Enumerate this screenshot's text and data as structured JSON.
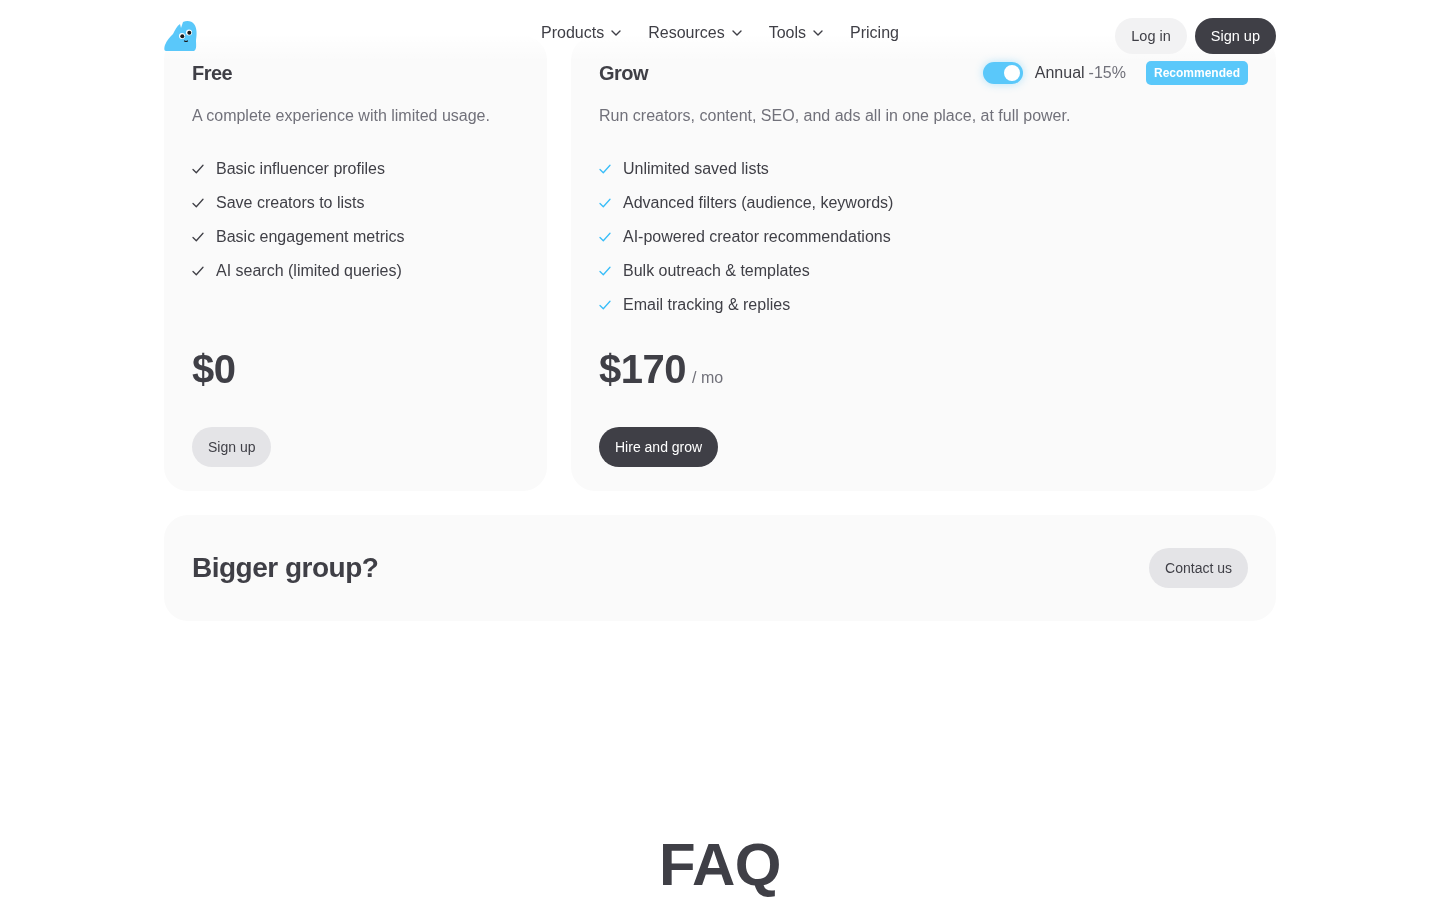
{
  "header": {
    "nav": [
      {
        "label": "Products",
        "has_menu": true
      },
      {
        "label": "Resources",
        "has_menu": true
      },
      {
        "label": "Tools",
        "has_menu": true
      },
      {
        "label": "Pricing",
        "has_menu": false
      }
    ],
    "actions": [
      {
        "label": "Log in",
        "kind": "secondary"
      },
      {
        "label": "Sign up",
        "kind": "primary"
      }
    ]
  },
  "plans": [
    {
      "name": "Free",
      "featured": false,
      "description": "A complete experience with limited usage.",
      "features": [
        "Basic influencer profiles",
        "Save creators to lists",
        "Basic engagement metrics",
        "AI search (limited queries)"
      ],
      "price": "$0",
      "button": {
        "label": "Sign up",
        "kind": "secondary"
      }
    },
    {
      "name": "Grow",
      "featured": true,
      "billing_toggle": {
        "on": true,
        "label": "Annual",
        "discount": "-15%"
      },
      "badge": "Recommended",
      "description": "Run creators, content, SEO, and ads all in one place, at full power.",
      "features": [
        "Unlimited saved lists",
        "Advanced filters (audience, keywords)",
        "AI-powered creator recommendations",
        "Bulk outreach & templates",
        "Email tracking & replies"
      ],
      "price": "$170",
      "period": "/ mo",
      "button": {
        "label": "Hire and grow",
        "kind": "primary"
      }
    }
  ],
  "contact_banner": {
    "title": "Bigger group?",
    "button": {
      "label": "Contact us",
      "kind": "secondary"
    }
  },
  "faq": {
    "title": "FAQ"
  }
}
